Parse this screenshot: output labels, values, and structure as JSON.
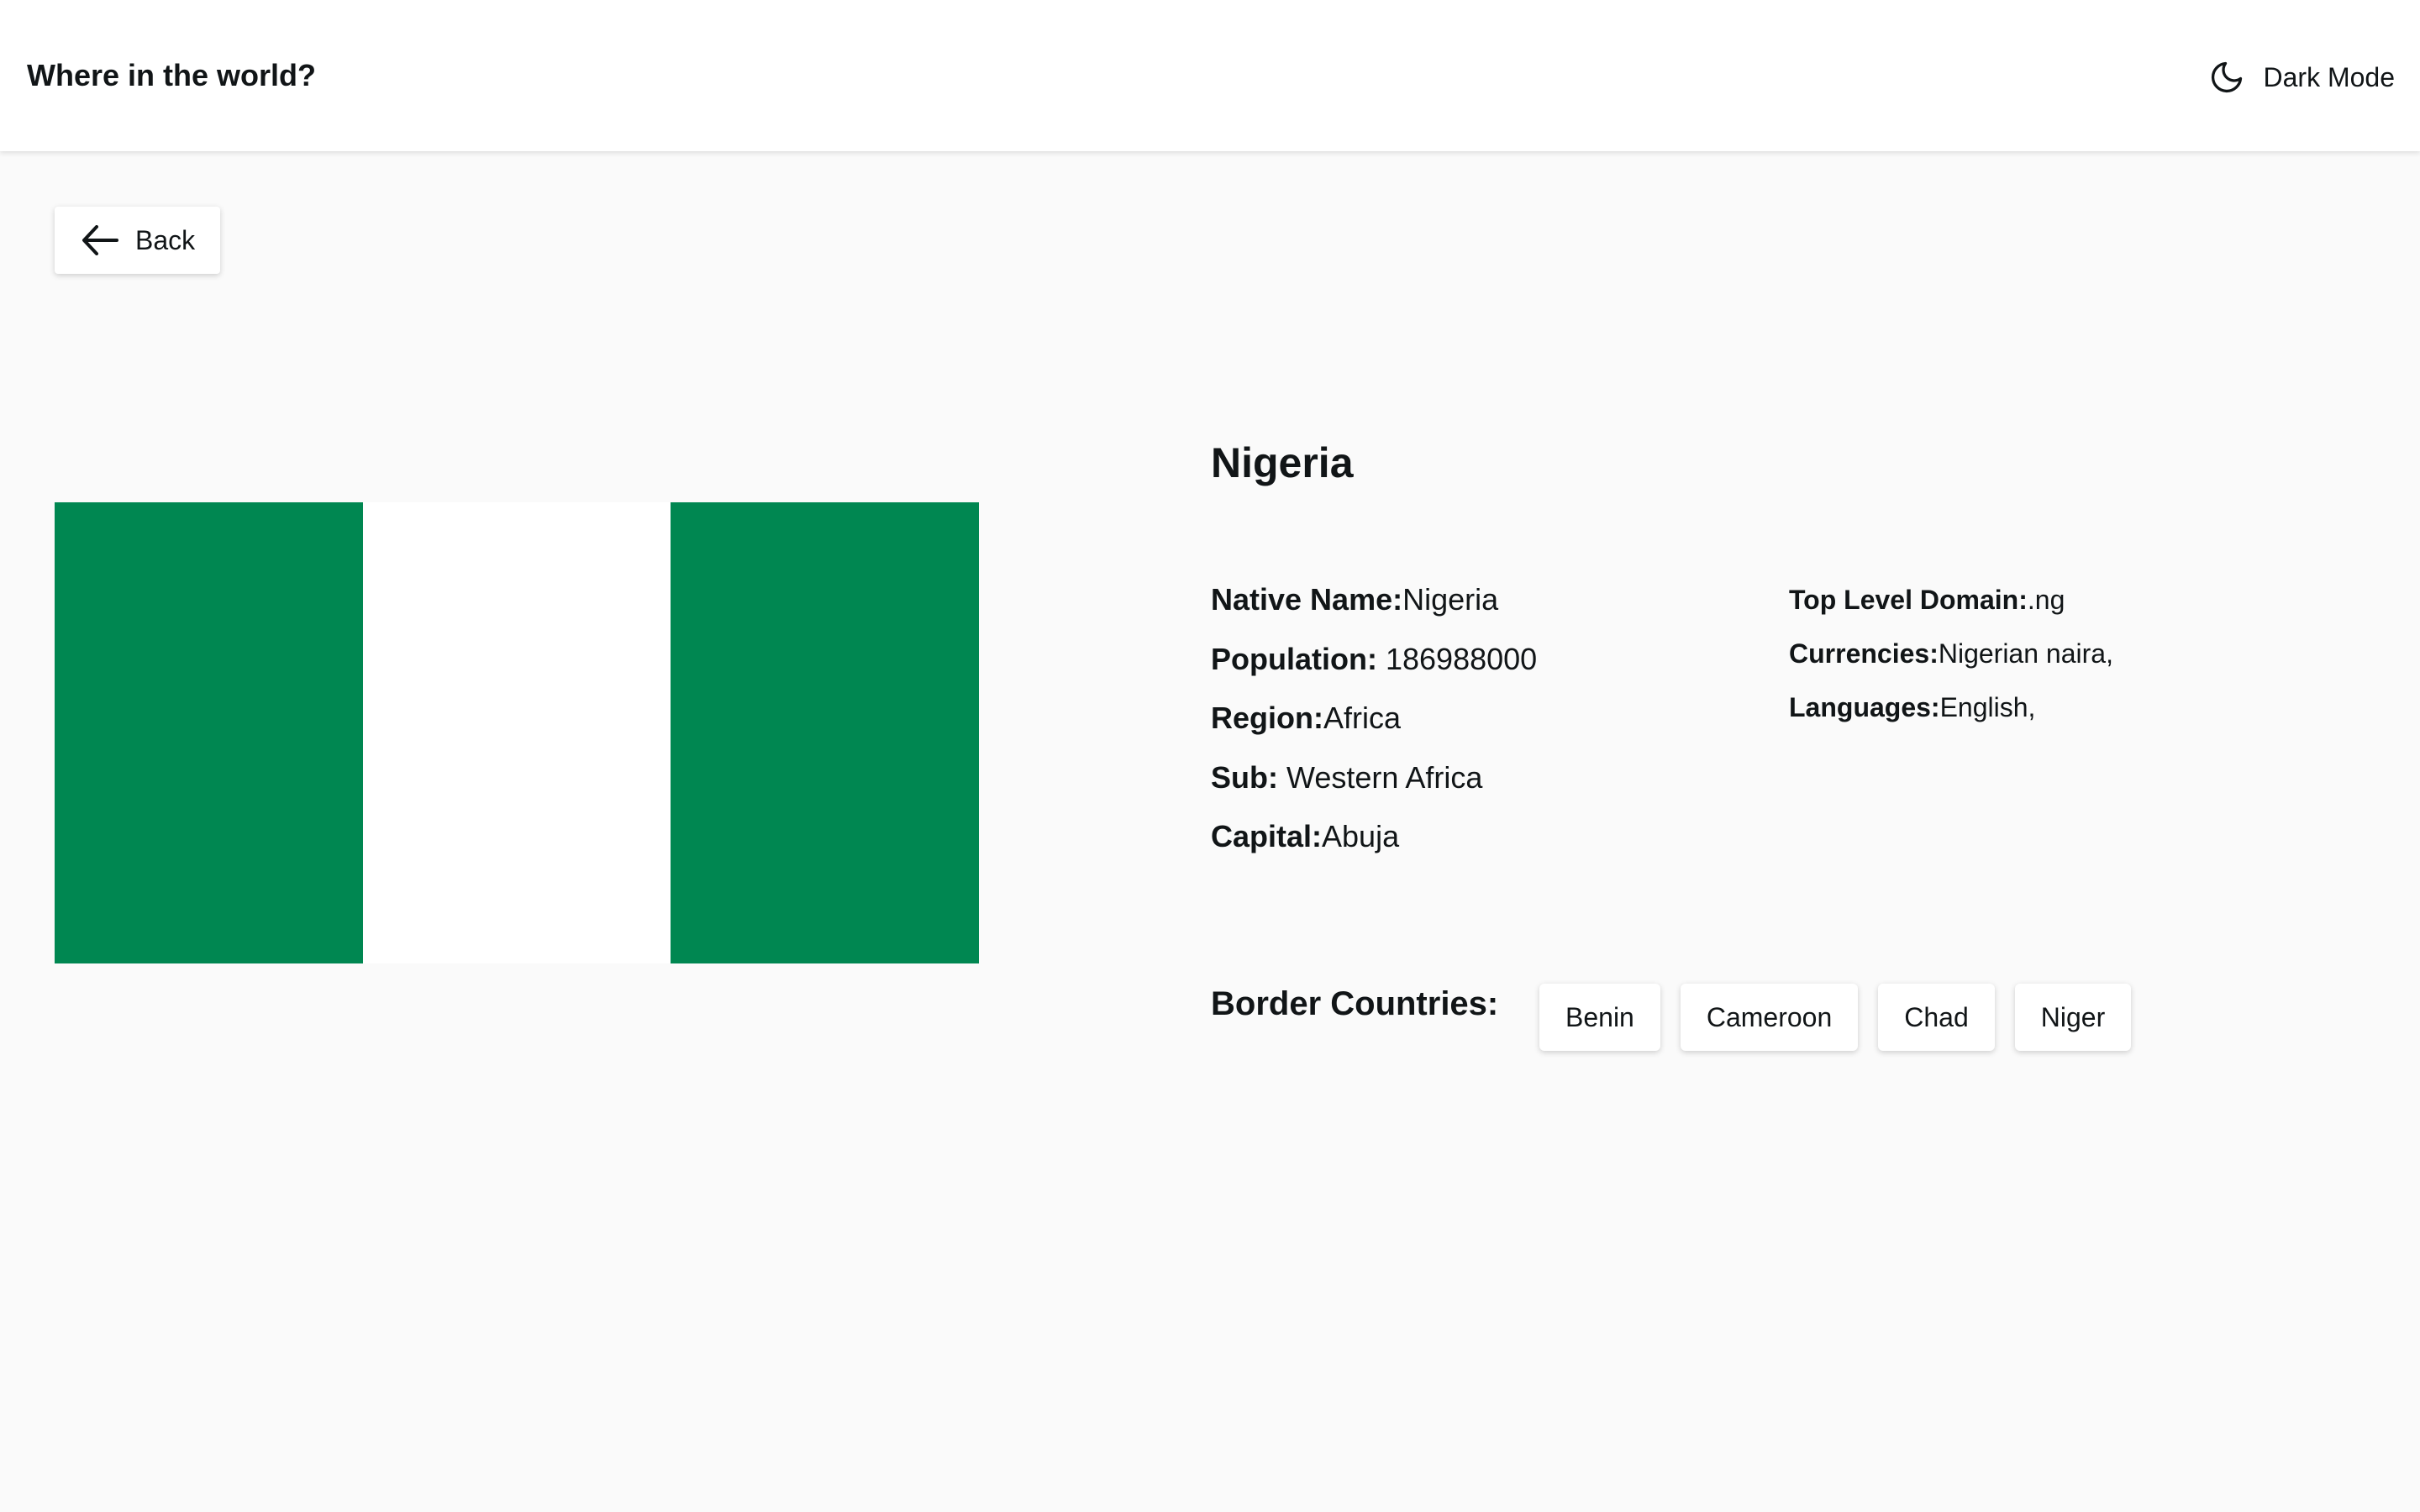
{
  "header": {
    "title": "Where in the world?",
    "dark_mode_label": "Dark Mode",
    "dark_mode_icon": "moon-icon"
  },
  "back_button": {
    "label": "Back",
    "icon": "arrow-left-icon"
  },
  "flag": {
    "bands": [
      "#008751",
      "#ffffff",
      "#008751"
    ]
  },
  "country": {
    "name": "Nigeria",
    "native_name_label": "Native Name:",
    "native_name": "Nigeria",
    "population_label": "Population:",
    "population": "186988000",
    "region_label": "Region:",
    "region": "Africa",
    "subregion_label": "Sub:",
    "subregion": "Western Africa",
    "capital_label": "Capital:",
    "capital": "Abuja",
    "tld_label": "Top Level Domain:",
    "tld": ".ng",
    "currencies_label": "Currencies:",
    "currencies": "Nigerian naira,",
    "languages_label": "Languages:",
    "languages": "English,"
  },
  "border_countries": {
    "label": "Border Countries:",
    "items": [
      "Benin",
      "Cameroon",
      "Chad",
      "Niger"
    ]
  },
  "colors": {
    "background": "#fafafa",
    "surface": "#ffffff",
    "text": "#111517",
    "flag_green": "#008751"
  }
}
